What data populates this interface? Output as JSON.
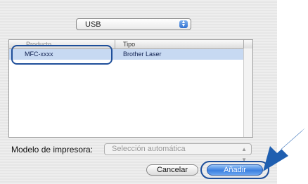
{
  "connection_select": {
    "value": "USB"
  },
  "printer_list": {
    "columns": [
      "Producto",
      "Tipo"
    ],
    "rows": [
      {
        "product": "MFC-xxxx",
        "type": "Brother Laser"
      }
    ]
  },
  "model": {
    "label": "Modelo de impresora:",
    "value": "Selección automática"
  },
  "buttons": {
    "cancel": "Cancelar",
    "add": "Añadir"
  },
  "colors": {
    "highlight": "#1f4f9a",
    "selection": "#c7d9f2",
    "primary_button": "#3a7fe0",
    "callout_arrow": "#1f5fb0"
  },
  "icons": {
    "popup_arrows": "up-down-chevrons",
    "callout": "pointing-arrow"
  }
}
